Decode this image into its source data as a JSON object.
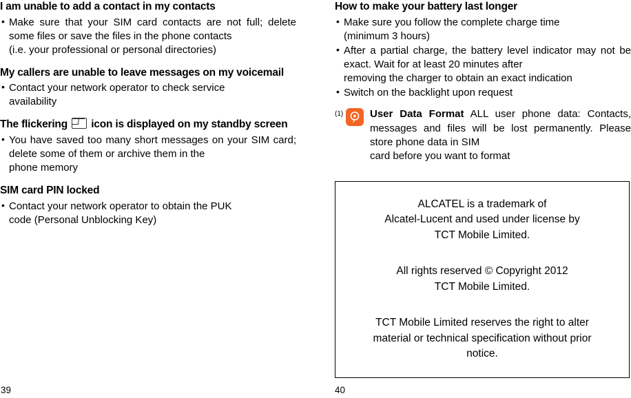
{
  "left_column": {
    "section1": {
      "heading": "I am unable to add a contact in my contacts",
      "bullet1_line1": "Make sure that your SIM card contacts are not full;",
      "bullet1_line2": "delete some files or save the files in the phone contacts",
      "bullet1_line3": "(i.e. your professional or personal directories)"
    },
    "section2": {
      "heading_line1": "My callers are unable to leave messages on my",
      "heading_line2": "voicemail",
      "bullet1_line1": "Contact your network operator to check service",
      "bullet1_line2": "availability"
    },
    "section3": {
      "heading_part1": "The flickering",
      "heading_part2": "icon is displayed on my standby",
      "heading_line2": "screen",
      "bullet1_line1": "You have saved too many short messages on your",
      "bullet1_line2": "SIM card; delete some of them or archive them in the",
      "bullet1_line3": "phone memory"
    },
    "section4": {
      "heading": "SIM card PIN locked",
      "bullet1_line1": "Contact your network operator to obtain the PUK",
      "bullet1_line2": "code (Personal Unblocking Key)"
    },
    "folio": "39"
  },
  "right_column": {
    "section1": {
      "heading": "How to make your battery last longer",
      "bullet1_line1": "Make sure you follow the complete charge time",
      "bullet1_line2": "(minimum 3 hours)",
      "bullet2_line1": "After a partial charge, the battery level indicator",
      "bullet2_line2": "may not be exact. Wait for at least 20 minutes after",
      "bullet2_line3": "removing the charger to obtain an exact indication",
      "bullet3_line1": "Switch on the backlight upon request"
    },
    "note": {
      "marker": "(1)",
      "icon_name": "note-warning-icon",
      "bold_text": "User Data Format",
      "line1_rest": "ALL user phone data:",
      "line2": "Contacts, messages and files will be lost",
      "line3": "permanently. Please store phone data in SIM",
      "line4": "card before you want to format"
    },
    "trademark_box": {
      "para1_line1": "ALCATEL is a trademark of",
      "para1_line2": "Alcatel-Lucent and used under license by",
      "para1_line3": "TCT Mobile Limited.",
      "para2_line1": "All rights reserved ©  Copyright 2012",
      "para2_line2": "TCT Mobile Limited.",
      "para3_line1": "TCT Mobile Limited reserves the right to alter",
      "para3_line2": "material or technical specification without prior",
      "para3_line3": "notice."
    },
    "folio": "40"
  }
}
